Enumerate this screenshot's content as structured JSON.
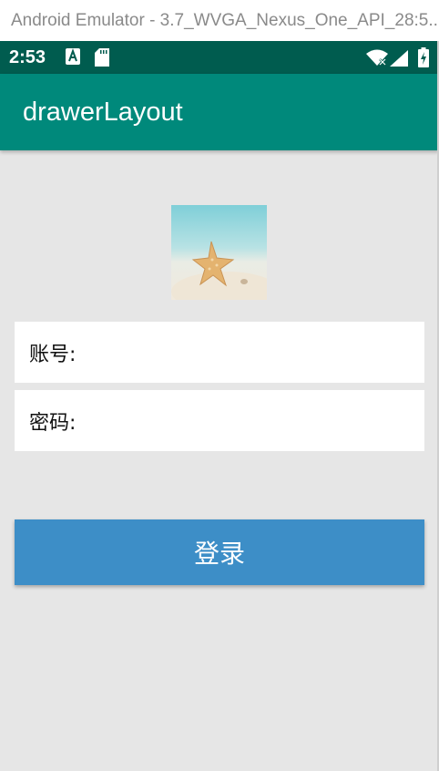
{
  "window": {
    "title": "Android Emulator - 3.7_WVGA_Nexus_One_API_28:5..."
  },
  "status_bar": {
    "time": "2:53",
    "icons": [
      "accessibility-a-icon",
      "sd-card-icon",
      "wifi-icon",
      "signal-icon",
      "battery-icon"
    ]
  },
  "app_bar": {
    "title": "drawerLayout"
  },
  "avatar": {
    "icon": "starfish-image"
  },
  "form": {
    "account_label": "账号:",
    "account_value": "",
    "password_label": "密码:",
    "password_value": ""
  },
  "login_button": {
    "label": "登录"
  },
  "colors": {
    "status_bar": "#005c4f",
    "app_bar": "#00897b",
    "background": "#e6e6e6",
    "button": "#3d8ec7"
  }
}
